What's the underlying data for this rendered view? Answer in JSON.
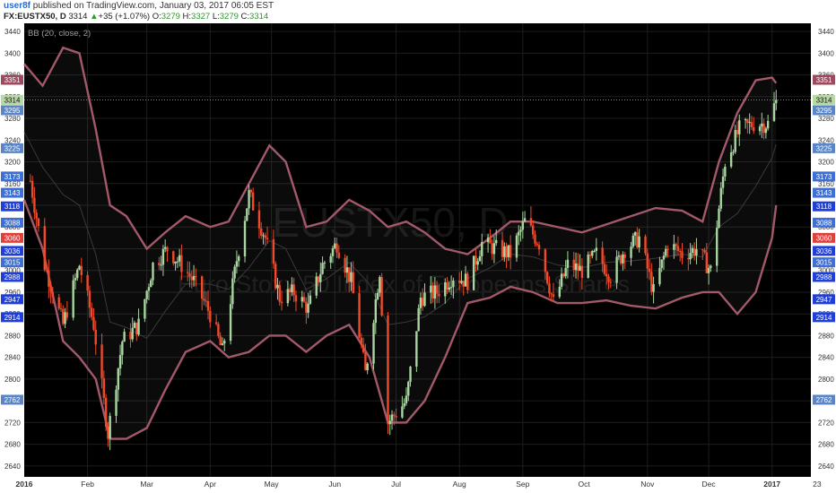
{
  "header": {
    "user": "user8f",
    "published": "published on TradingView.com, January 03, 2017 06:05 EST",
    "symbol": "FX:EUSTX50, D",
    "last": "3314",
    "change_arrow": "▲",
    "change": "+35 (+1.07%)",
    "o_label": "O:",
    "o": "3279",
    "h_label": "H:",
    "h": "3327",
    "l_label": "L:",
    "l": "3279",
    "c_label": "C:",
    "c": "3314"
  },
  "indicator_label": "BB (20, close, 2)",
  "watermark": {
    "symbol": "EUSTX50, D",
    "description": "Euro Stoxx 50 Index of Europeans Shares"
  },
  "chart_data": {
    "type": "candlestick",
    "y_range": [
      2620,
      3455
    ],
    "x_range": [
      "2016-01-01",
      "2017-01-20"
    ],
    "y_ticks": [
      2640,
      2680,
      2720,
      2760,
      2800,
      2840,
      2880,
      2920,
      2960,
      3000,
      3040,
      3080,
      3120,
      3160,
      3200,
      3240,
      3280,
      3320,
      3360,
      3400,
      3440
    ],
    "x_labels": [
      {
        "date": "2016-01-01",
        "label": "2016"
      },
      {
        "date": "2016-02-01",
        "label": "Feb"
      },
      {
        "date": "2016-03-01",
        "label": "Mar"
      },
      {
        "date": "2016-04-01",
        "label": "Apr"
      },
      {
        "date": "2016-05-01",
        "label": "May"
      },
      {
        "date": "2016-06-01",
        "label": "Jun"
      },
      {
        "date": "2016-07-01",
        "label": "Jul"
      },
      {
        "date": "2016-08-01",
        "label": "Aug"
      },
      {
        "date": "2016-09-01",
        "label": "Sep"
      },
      {
        "date": "2016-10-01",
        "label": "Oct"
      },
      {
        "date": "2016-11-01",
        "label": "Nov"
      },
      {
        "date": "2016-12-01",
        "label": "Dec"
      },
      {
        "date": "2017-01-01",
        "label": "2017"
      },
      {
        "date": "2017-01-23",
        "label": "23"
      }
    ],
    "price_tags": [
      {
        "value": 3351,
        "bg": "#9c4a5f",
        "fg": "#ffffff"
      },
      {
        "value": 3314,
        "bg": "#b9d8a8",
        "fg": "#111111"
      },
      {
        "value": 3295,
        "bg": "#5a86c8",
        "fg": "#ffffff"
      },
      {
        "value": 3225,
        "bg": "#5a86c8",
        "fg": "#ffffff"
      },
      {
        "value": 3173,
        "bg": "#3d6fd6",
        "fg": "#ffffff"
      },
      {
        "value": 3143,
        "bg": "#3d6fd6",
        "fg": "#ffffff"
      },
      {
        "value": 3118,
        "bg": "#1f3fd8",
        "fg": "#ffffff"
      },
      {
        "value": 3088,
        "bg": "#3d6fd6",
        "fg": "#ffffff"
      },
      {
        "value": 3060,
        "bg": "#e0403a",
        "fg": "#ffffff"
      },
      {
        "value": 3036,
        "bg": "#1f3fd8",
        "fg": "#ffffff"
      },
      {
        "value": 3015,
        "bg": "#3d6fd6",
        "fg": "#ffffff"
      },
      {
        "value": 2988,
        "bg": "#1f3fd8",
        "fg": "#ffffff"
      },
      {
        "value": 2947,
        "bg": "#1f3fd8",
        "fg": "#ffffff"
      },
      {
        "value": 2914,
        "bg": "#1f3fd8",
        "fg": "#ffffff"
      },
      {
        "value": 2762,
        "bg": "#5a86c8",
        "fg": "#ffffff"
      }
    ],
    "last_price": 3314,
    "colors": {
      "up": "#a8d5a0",
      "down": "#f04a2a",
      "band": "#a3596a",
      "basis": "#3a3a3a",
      "bg": "#000000",
      "grid": "#1d1d1d"
    },
    "close_series": [
      {
        "date": "2016-01-04",
        "close": 3165
      },
      {
        "date": "2016-01-11",
        "close": 3010
      },
      {
        "date": "2016-01-20",
        "close": 2900
      },
      {
        "date": "2016-01-28",
        "close": 3010
      },
      {
        "date": "2016-02-04",
        "close": 2900
      },
      {
        "date": "2016-02-11",
        "close": 2700
      },
      {
        "date": "2016-02-18",
        "close": 2870
      },
      {
        "date": "2016-02-26",
        "close": 2900
      },
      {
        "date": "2016-03-04",
        "close": 3010
      },
      {
        "date": "2016-03-11",
        "close": 3040
      },
      {
        "date": "2016-03-18",
        "close": 3010
      },
      {
        "date": "2016-03-24",
        "close": 2980
      },
      {
        "date": "2016-04-01",
        "close": 2920
      },
      {
        "date": "2016-04-07",
        "close": 2850
      },
      {
        "date": "2016-04-14",
        "close": 3020
      },
      {
        "date": "2016-04-20",
        "close": 3140
      },
      {
        "date": "2016-04-28",
        "close": 3060
      },
      {
        "date": "2016-05-05",
        "close": 2950
      },
      {
        "date": "2016-05-12",
        "close": 2960
      },
      {
        "date": "2016-05-19",
        "close": 2930
      },
      {
        "date": "2016-05-26",
        "close": 3010
      },
      {
        "date": "2016-06-02",
        "close": 3050
      },
      {
        "date": "2016-06-09",
        "close": 2980
      },
      {
        "date": "2016-06-16",
        "close": 2810
      },
      {
        "date": "2016-06-23",
        "close": 3000
      },
      {
        "date": "2016-06-27",
        "close": 2720
      },
      {
        "date": "2016-07-06",
        "close": 2760
      },
      {
        "date": "2016-07-13",
        "close": 2950
      },
      {
        "date": "2016-07-21",
        "close": 2960
      },
      {
        "date": "2016-07-29",
        "close": 2990
      },
      {
        "date": "2016-08-05",
        "close": 2980
      },
      {
        "date": "2016-08-12",
        "close": 3050
      },
      {
        "date": "2016-08-19",
        "close": 3040
      },
      {
        "date": "2016-08-26",
        "close": 3030
      },
      {
        "date": "2016-09-02",
        "close": 3090
      },
      {
        "date": "2016-09-09",
        "close": 3050
      },
      {
        "date": "2016-09-16",
        "close": 2940
      },
      {
        "date": "2016-09-23",
        "close": 3010
      },
      {
        "date": "2016-09-30",
        "close": 3000
      },
      {
        "date": "2016-10-07",
        "close": 3030
      },
      {
        "date": "2016-10-14",
        "close": 2990
      },
      {
        "date": "2016-10-21",
        "close": 3040
      },
      {
        "date": "2016-10-28",
        "close": 3060
      },
      {
        "date": "2016-11-04",
        "close": 2960
      },
      {
        "date": "2016-11-11",
        "close": 3050
      },
      {
        "date": "2016-11-18",
        "close": 3030
      },
      {
        "date": "2016-11-25",
        "close": 3040
      },
      {
        "date": "2016-12-02",
        "close": 3000
      },
      {
        "date": "2016-12-09",
        "close": 3200
      },
      {
        "date": "2016-12-16",
        "close": 3260
      },
      {
        "date": "2016-12-23",
        "close": 3270
      },
      {
        "date": "2016-12-30",
        "close": 3270
      },
      {
        "date": "2017-01-03",
        "close": 3314
      }
    ],
    "upper_band": [
      {
        "date": "2016-01-01",
        "value": 3380
      },
      {
        "date": "2016-01-10",
        "value": 3340
      },
      {
        "date": "2016-01-20",
        "value": 3410
      },
      {
        "date": "2016-01-28",
        "value": 3400
      },
      {
        "date": "2016-02-05",
        "value": 3260
      },
      {
        "date": "2016-02-12",
        "value": 3120
      },
      {
        "date": "2016-02-20",
        "value": 3100
      },
      {
        "date": "2016-03-01",
        "value": 3040
      },
      {
        "date": "2016-03-10",
        "value": 3070
      },
      {
        "date": "2016-03-20",
        "value": 3100
      },
      {
        "date": "2016-04-01",
        "value": 3080
      },
      {
        "date": "2016-04-10",
        "value": 3090
      },
      {
        "date": "2016-04-20",
        "value": 3160
      },
      {
        "date": "2016-04-30",
        "value": 3230
      },
      {
        "date": "2016-05-08",
        "value": 3200
      },
      {
        "date": "2016-05-18",
        "value": 3080
      },
      {
        "date": "2016-05-28",
        "value": 3090
      },
      {
        "date": "2016-06-08",
        "value": 3130
      },
      {
        "date": "2016-06-18",
        "value": 3110
      },
      {
        "date": "2016-06-27",
        "value": 3080
      },
      {
        "date": "2016-07-06",
        "value": 3090
      },
      {
        "date": "2016-07-15",
        "value": 3070
      },
      {
        "date": "2016-07-25",
        "value": 3040
      },
      {
        "date": "2016-08-05",
        "value": 3030
      },
      {
        "date": "2016-08-16",
        "value": 3060
      },
      {
        "date": "2016-08-26",
        "value": 3090
      },
      {
        "date": "2016-09-06",
        "value": 3090
      },
      {
        "date": "2016-09-18",
        "value": 3080
      },
      {
        "date": "2016-09-30",
        "value": 3070
      },
      {
        "date": "2016-10-12",
        "value": 3085
      },
      {
        "date": "2016-10-24",
        "value": 3100
      },
      {
        "date": "2016-11-05",
        "value": 3115
      },
      {
        "date": "2016-11-18",
        "value": 3110
      },
      {
        "date": "2016-11-28",
        "value": 3090
      },
      {
        "date": "2016-12-06",
        "value": 3200
      },
      {
        "date": "2016-12-15",
        "value": 3290
      },
      {
        "date": "2016-12-24",
        "value": 3350
      },
      {
        "date": "2017-01-01",
        "value": 3355
      },
      {
        "date": "2017-01-03",
        "value": 3345
      }
    ],
    "lower_band": [
      {
        "date": "2016-01-01",
        "value": 3130
      },
      {
        "date": "2016-01-10",
        "value": 3040
      },
      {
        "date": "2016-01-20",
        "value": 2870
      },
      {
        "date": "2016-01-28",
        "value": 2840
      },
      {
        "date": "2016-02-05",
        "value": 2800
      },
      {
        "date": "2016-02-12",
        "value": 2690
      },
      {
        "date": "2016-02-20",
        "value": 2690
      },
      {
        "date": "2016-03-01",
        "value": 2710
      },
      {
        "date": "2016-03-10",
        "value": 2780
      },
      {
        "date": "2016-03-20",
        "value": 2850
      },
      {
        "date": "2016-04-01",
        "value": 2870
      },
      {
        "date": "2016-04-10",
        "value": 2840
      },
      {
        "date": "2016-04-20",
        "value": 2850
      },
      {
        "date": "2016-04-30",
        "value": 2880
      },
      {
        "date": "2016-05-08",
        "value": 2880
      },
      {
        "date": "2016-05-18",
        "value": 2850
      },
      {
        "date": "2016-05-28",
        "value": 2880
      },
      {
        "date": "2016-06-08",
        "value": 2900
      },
      {
        "date": "2016-06-18",
        "value": 2840
      },
      {
        "date": "2016-06-27",
        "value": 2720
      },
      {
        "date": "2016-07-06",
        "value": 2720
      },
      {
        "date": "2016-07-15",
        "value": 2760
      },
      {
        "date": "2016-07-25",
        "value": 2840
      },
      {
        "date": "2016-08-05",
        "value": 2940
      },
      {
        "date": "2016-08-16",
        "value": 2950
      },
      {
        "date": "2016-08-26",
        "value": 2970
      },
      {
        "date": "2016-09-06",
        "value": 2960
      },
      {
        "date": "2016-09-18",
        "value": 2940
      },
      {
        "date": "2016-09-30",
        "value": 2940
      },
      {
        "date": "2016-10-12",
        "value": 2945
      },
      {
        "date": "2016-10-24",
        "value": 2935
      },
      {
        "date": "2016-11-05",
        "value": 2930
      },
      {
        "date": "2016-11-18",
        "value": 2950
      },
      {
        "date": "2016-11-28",
        "value": 2960
      },
      {
        "date": "2016-12-06",
        "value": 2960
      },
      {
        "date": "2016-12-15",
        "value": 2920
      },
      {
        "date": "2016-12-24",
        "value": 2960
      },
      {
        "date": "2017-01-01",
        "value": 3060
      },
      {
        "date": "2017-01-03",
        "value": 3120
      }
    ]
  }
}
